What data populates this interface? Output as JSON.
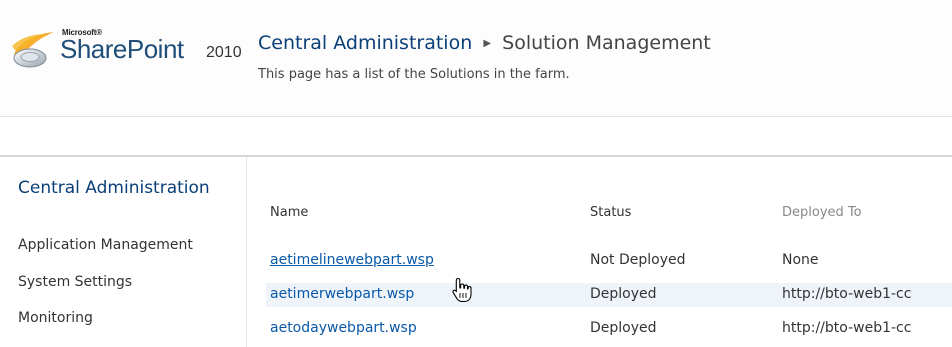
{
  "header": {
    "brand_prefix": "Microsoft®",
    "brand_name": "SharePoint",
    "brand_year": "2010",
    "breadcrumb_root": "Central Administration",
    "breadcrumb_current": "Solution Management",
    "subtitle": "This page has a list of the Solutions in the farm."
  },
  "leftnav": {
    "heading": "Central Administration",
    "items": [
      "Application Management",
      "System Settings",
      "Monitoring"
    ]
  },
  "table": {
    "columns": [
      "Name",
      "Status",
      "Deployed To"
    ],
    "rows": [
      {
        "name": "aetimelinewebpart.wsp",
        "status": "Not Deployed",
        "deployed_to": "None"
      },
      {
        "name": "aetimerwebpart.wsp",
        "status": "Deployed",
        "deployed_to": "http://bto-web1-cc"
      },
      {
        "name": "aetodaywebpart.wsp",
        "status": "Deployed",
        "deployed_to": "http://bto-web1-cc"
      }
    ]
  },
  "icons": {
    "logo": "sharepoint-logo-icon",
    "breadcrumb_separator": "triangle-right-icon",
    "cursor": "hand-pointer-icon"
  },
  "colors": {
    "link": "#0a58a8",
    "title_blue": "#0a3f78",
    "row_highlight": "#eef4fa"
  }
}
